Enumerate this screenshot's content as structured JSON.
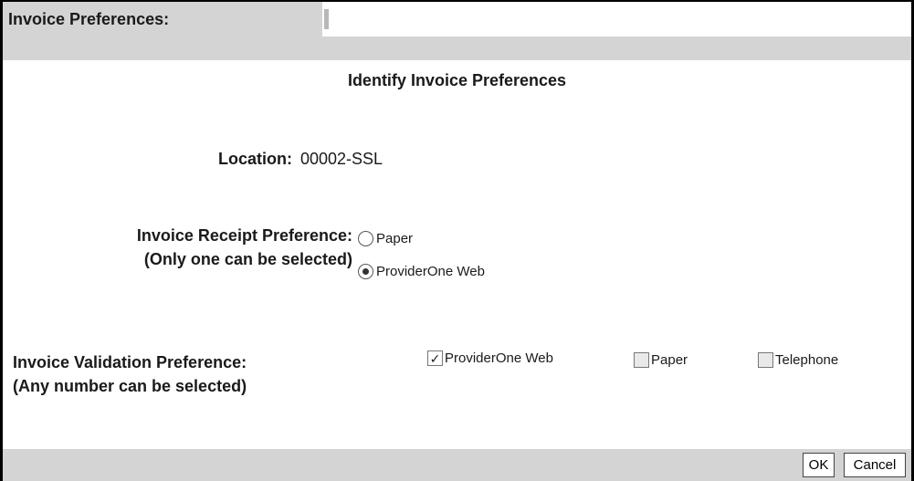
{
  "header": {
    "tab_label": "Invoice Preferences:"
  },
  "page_title": "Identify Invoice Preferences",
  "location": {
    "label": "Location:",
    "value": "00002-SSL"
  },
  "receipt_preference": {
    "label_line1": "Invoice Receipt Preference:",
    "label_line2": "(Only one can be selected)",
    "options": [
      {
        "label": "Paper",
        "selected": false
      },
      {
        "label": "ProviderOne Web",
        "selected": true
      }
    ]
  },
  "validation_preference": {
    "label_line1": "Invoice Validation Preference:",
    "label_line2": "(Any number can be selected)",
    "options": [
      {
        "label": "ProviderOne Web",
        "checked": true
      },
      {
        "label": "Paper",
        "checked": false
      },
      {
        "label": "Telephone",
        "checked": false
      }
    ]
  },
  "footer": {
    "ok_label": "OK",
    "cancel_label": "Cancel"
  }
}
